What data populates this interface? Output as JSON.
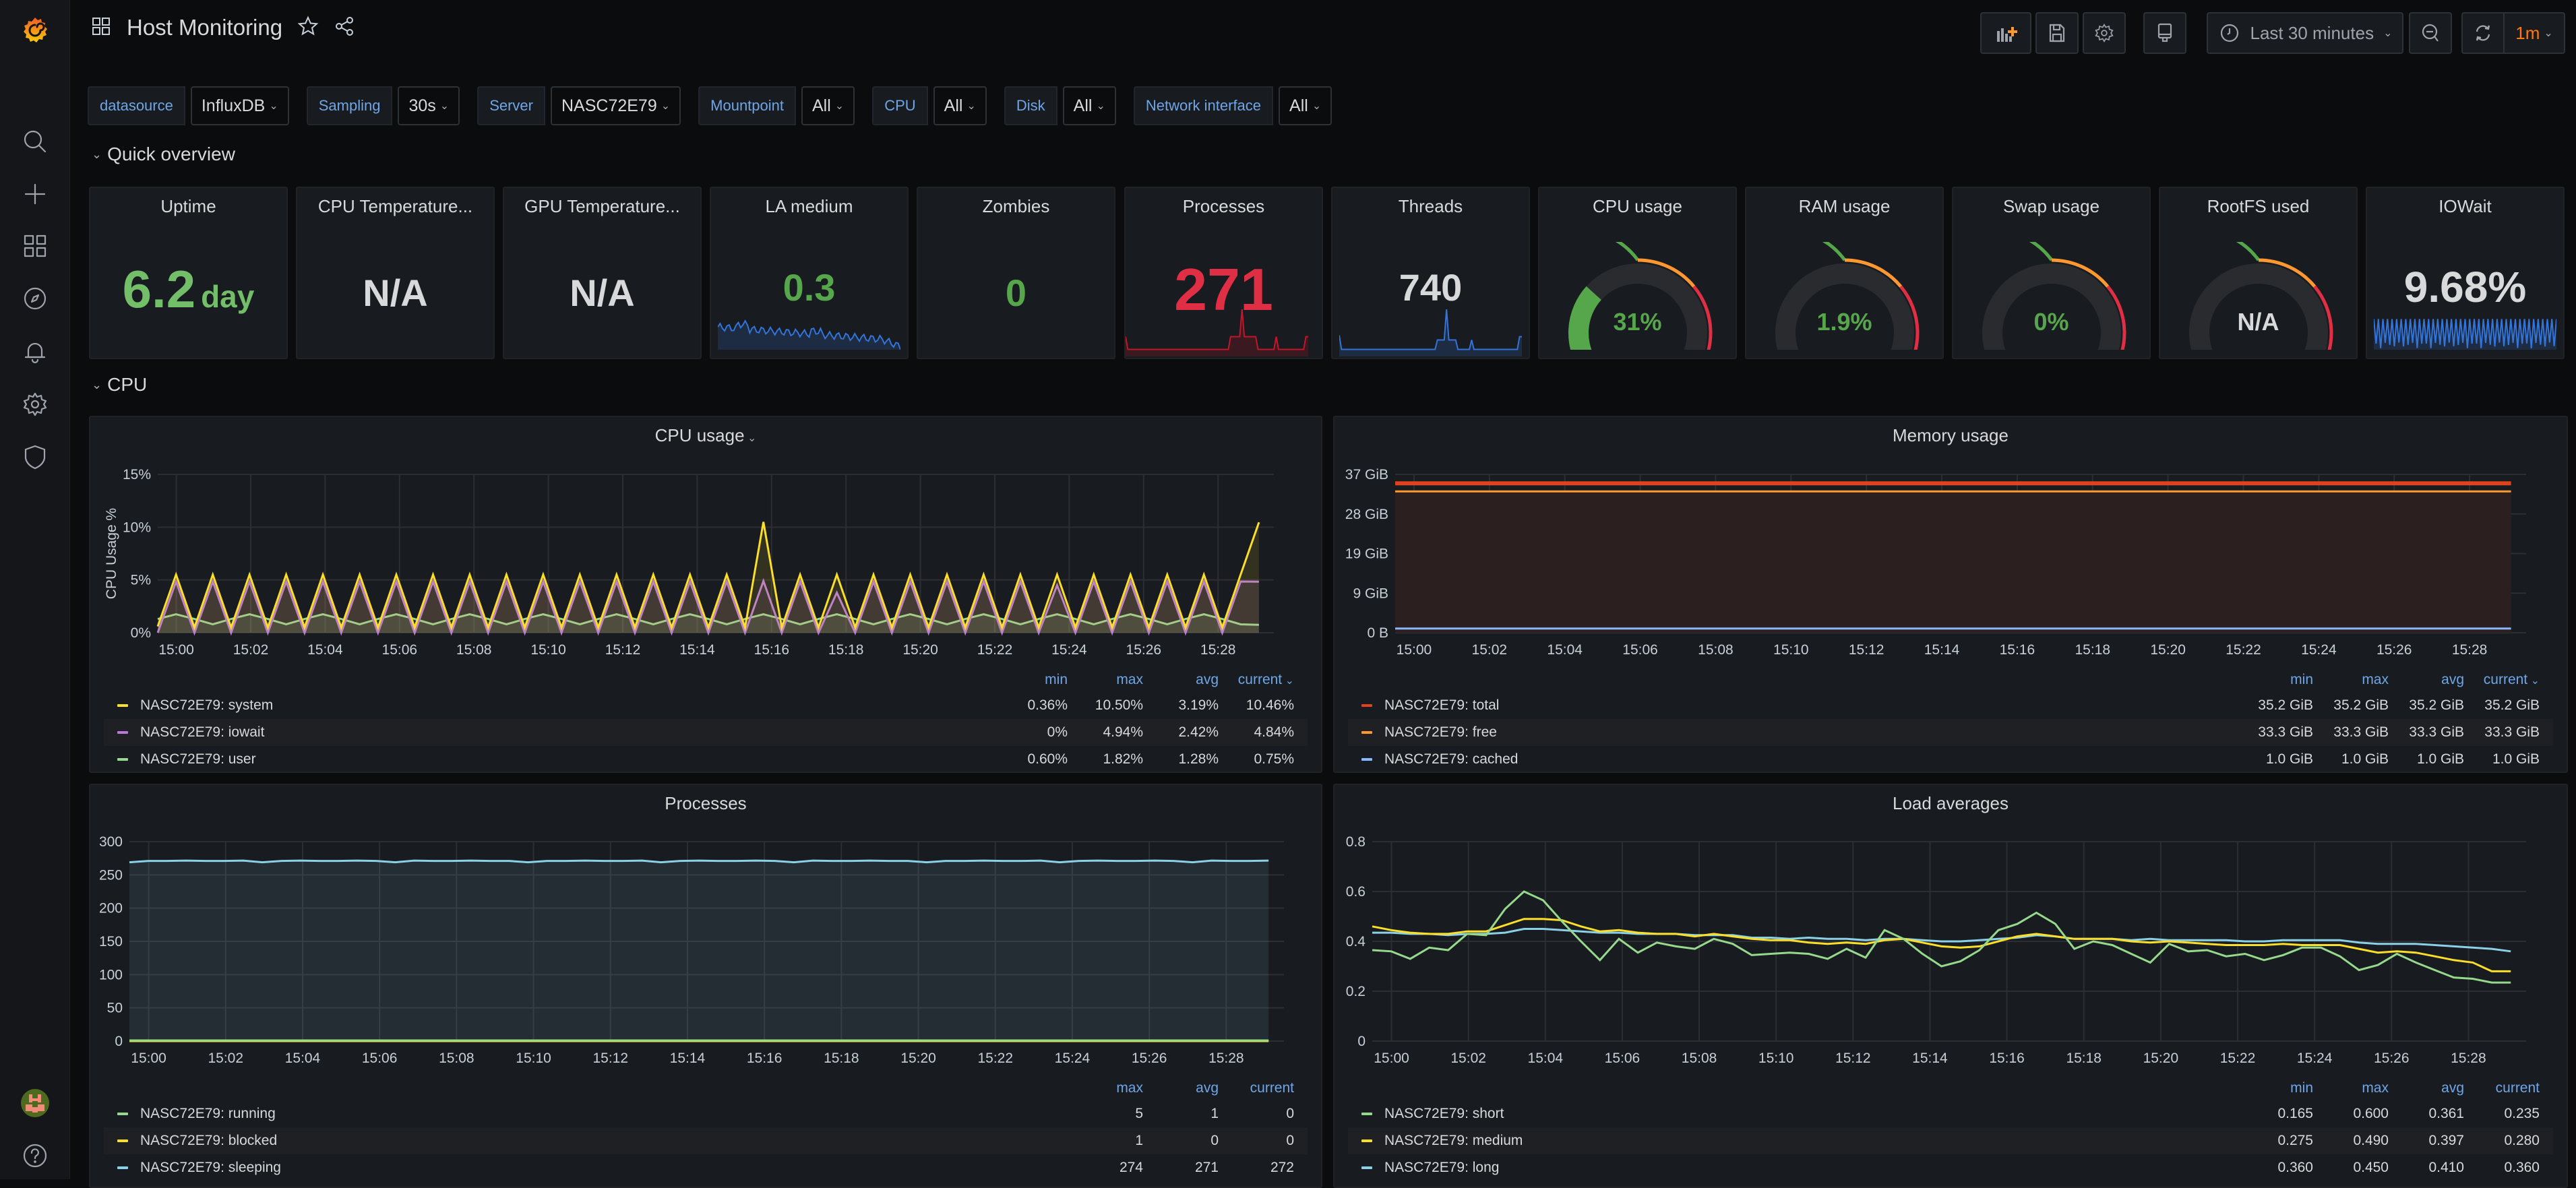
{
  "app": {
    "title": "Host Monitoring"
  },
  "sidebar": {
    "items": [
      {
        "name": "search",
        "icon": "search-icon"
      },
      {
        "name": "create",
        "icon": "plus-icon"
      },
      {
        "name": "dashboards",
        "icon": "apps-icon"
      },
      {
        "name": "explore",
        "icon": "compass-icon"
      },
      {
        "name": "alerting",
        "icon": "bell-icon"
      },
      {
        "name": "configuration",
        "icon": "gear-icon"
      },
      {
        "name": "server-admin",
        "icon": "shield-icon"
      }
    ],
    "bottom": [
      {
        "name": "profile",
        "icon": "avatar"
      },
      {
        "name": "help",
        "icon": "question-icon"
      }
    ]
  },
  "toolbar": {
    "add_panel": "add-panel-icon",
    "save": "save-icon",
    "settings": "gear-icon",
    "tv_mode": "monitor-icon",
    "time_range": "Last 30 minutes",
    "zoom_out": "zoom-out-icon",
    "refresh": "sync-icon",
    "refresh_interval": "1m",
    "accent": "#ff780a"
  },
  "variables": [
    {
      "label": "datasource",
      "value": "InfluxDB"
    },
    {
      "label": "Sampling",
      "value": "30s"
    },
    {
      "label": "Server",
      "value": "NASC72E79"
    },
    {
      "label": "Mountpoint",
      "value": "All"
    },
    {
      "label": "CPU",
      "value": "All"
    },
    {
      "label": "Disk",
      "value": "All"
    },
    {
      "label": "Network interface",
      "value": "All"
    }
  ],
  "rows": {
    "quick_overview": "Quick overview",
    "cpu": "CPU"
  },
  "stats": [
    {
      "title": "Uptime",
      "value": "6.2",
      "unit": "day",
      "color": "#73bf69",
      "type": "stat"
    },
    {
      "title": "CPU Temperature...",
      "value": "N/A",
      "color": "#d8d9da",
      "type": "stat"
    },
    {
      "title": "GPU Temperature...",
      "value": "N/A",
      "color": "#d8d9da",
      "type": "stat"
    },
    {
      "title": "LA medium",
      "value": "0.3",
      "color": "#56a64b",
      "type": "spark",
      "spark_color": "#3274d9"
    },
    {
      "title": "Zombies",
      "value": "0",
      "color": "#56a64b",
      "type": "stat"
    },
    {
      "title": "Processes",
      "value": "271",
      "color": "#e02f44",
      "type": "spark",
      "spark_color": "#c4162a"
    },
    {
      "title": "Threads",
      "value": "740",
      "color": "#d8d9da",
      "type": "spark",
      "spark_color": "#3274d9"
    },
    {
      "title": "CPU usage",
      "value": "31%",
      "percent": 31,
      "color": "#56a64b",
      "type": "gauge"
    },
    {
      "title": "RAM usage",
      "value": "1.9%",
      "percent": 1.9,
      "color": "#56a64b",
      "type": "gauge"
    },
    {
      "title": "Swap usage",
      "value": "0%",
      "percent": 0,
      "color": "#56a64b",
      "type": "gauge"
    },
    {
      "title": "RootFS used",
      "value": "N/A",
      "percent": null,
      "color": "#d8d9da",
      "type": "gauge"
    },
    {
      "title": "IOWait",
      "value": "9.68%",
      "color": "#d8d9da",
      "type": "spark",
      "spark_color": "#3274d9"
    }
  ],
  "chart_data": [
    {
      "id": "cpu",
      "type": "line",
      "title": "CPU usage",
      "title_menu": true,
      "ylabel": "CPU Usage %",
      "yticks": [
        "0%",
        "5%",
        "10%",
        "15%"
      ],
      "ylim": [
        0,
        15
      ],
      "xticks": [
        "15:00",
        "15:02",
        "15:04",
        "15:06",
        "15:08",
        "15:10",
        "15:12",
        "15:14",
        "15:16",
        "15:18",
        "15:20",
        "15:22",
        "15:24",
        "15:26",
        "15:28"
      ],
      "xlim_minutes": [
        -0.5,
        29.5
      ],
      "legend_columns": [
        "min",
        "max",
        "avg",
        "current"
      ],
      "sort_column": "current",
      "series": [
        {
          "name": "NASC72E79: system",
          "color": "#fade2a",
          "stats": [
            "0.36%",
            "10.50%",
            "3.19%",
            "10.46%"
          ],
          "pattern": "cpu_system"
        },
        {
          "name": "NASC72E79: iowait",
          "color": "#b877d9",
          "stats": [
            "0%",
            "4.94%",
            "2.42%",
            "4.84%"
          ],
          "pattern": "cpu_iowait"
        },
        {
          "name": "NASC72E79: user",
          "color": "#96d98d",
          "stats": [
            "0.60%",
            "1.82%",
            "1.28%",
            "0.75%"
          ],
          "pattern": "cpu_user"
        }
      ]
    },
    {
      "id": "mem",
      "type": "area",
      "title": "Memory usage",
      "yticks": [
        "0 B",
        "9 GiB",
        "19 GiB",
        "28 GiB",
        "37 GiB"
      ],
      "ylim": [
        0,
        37.3
      ],
      "xticks": [
        "15:00",
        "15:02",
        "15:04",
        "15:06",
        "15:08",
        "15:10",
        "15:12",
        "15:14",
        "15:16",
        "15:18",
        "15:20",
        "15:22",
        "15:24",
        "15:26",
        "15:28"
      ],
      "xlim_minutes": [
        -0.5,
        29.5
      ],
      "legend_columns": [
        "min",
        "max",
        "avg",
        "current"
      ],
      "sort_column": "current",
      "series": [
        {
          "name": "NASC72E79: total",
          "color": "#e0421f",
          "stats": [
            "35.2 GiB",
            "35.2 GiB",
            "35.2 GiB",
            "35.2 GiB"
          ],
          "value": 35.2
        },
        {
          "name": "NASC72E79: free",
          "color": "#ff9830",
          "stats": [
            "33.3 GiB",
            "33.3 GiB",
            "33.3 GiB",
            "33.3 GiB"
          ],
          "value": 33.3
        },
        {
          "name": "NASC72E79: cached",
          "color": "#8ab8ff",
          "stats": [
            "1.0 GiB",
            "1.0 GiB",
            "1.0 GiB",
            "1.0 GiB"
          ],
          "value": 1.0
        }
      ]
    },
    {
      "id": "proc",
      "type": "area",
      "title": "Processes",
      "yticks": [
        "0",
        "50",
        "100",
        "150",
        "200",
        "250",
        "300"
      ],
      "ylim": [
        0,
        300
      ],
      "xticks": [
        "15:00",
        "15:02",
        "15:04",
        "15:06",
        "15:08",
        "15:10",
        "15:12",
        "15:14",
        "15:16",
        "15:18",
        "15:20",
        "15:22",
        "15:24",
        "15:26",
        "15:28"
      ],
      "xlim_minutes": [
        -0.5,
        29.5
      ],
      "legend_columns": [
        "max",
        "avg",
        "current"
      ],
      "series": [
        {
          "name": "NASC72E79: running",
          "color": "#96d98d",
          "stats": [
            "5",
            "1",
            "0"
          ],
          "value": 1
        },
        {
          "name": "NASC72E79: blocked",
          "color": "#fade2a",
          "stats": [
            "1",
            "0",
            "0"
          ],
          "value": 0
        },
        {
          "name": "NASC72E79: sleeping",
          "color": "#8ad1e8",
          "stats": [
            "274",
            "271",
            "272"
          ],
          "value": 271
        }
      ]
    },
    {
      "id": "load",
      "type": "line",
      "title": "Load averages",
      "yticks": [
        "0",
        "0.2",
        "0.4",
        "0.6",
        "0.8"
      ],
      "ylim": [
        0,
        0.8
      ],
      "xticks": [
        "15:00",
        "15:02",
        "15:04",
        "15:06",
        "15:08",
        "15:10",
        "15:12",
        "15:14",
        "15:16",
        "15:18",
        "15:20",
        "15:22",
        "15:24",
        "15:26",
        "15:28"
      ],
      "xlim_minutes": [
        -0.5,
        29.5
      ],
      "legend_columns": [
        "min",
        "max",
        "avg",
        "current"
      ],
      "series": [
        {
          "name": "NASC72E79: short",
          "color": "#96d98d",
          "stats": [
            "0.165",
            "0.600",
            "0.361",
            "0.235"
          ],
          "values": [
            0.365,
            0.36,
            0.33,
            0.375,
            0.365,
            0.43,
            0.425,
            0.53,
            0.6,
            0.565,
            0.48,
            0.4,
            0.325,
            0.41,
            0.355,
            0.395,
            0.38,
            0.37,
            0.41,
            0.39,
            0.345,
            0.35,
            0.355,
            0.35,
            0.33,
            0.37,
            0.335,
            0.445,
            0.41,
            0.35,
            0.3,
            0.32,
            0.365,
            0.445,
            0.47,
            0.515,
            0.47,
            0.37,
            0.4,
            0.385,
            0.35,
            0.315,
            0.39,
            0.36,
            0.365,
            0.34,
            0.35,
            0.325,
            0.345,
            0.375,
            0.375,
            0.34,
            0.285,
            0.305,
            0.35,
            0.315,
            0.285,
            0.255,
            0.25,
            0.235,
            0.235
          ]
        },
        {
          "name": "NASC72E79: medium",
          "color": "#fade2a",
          "stats": [
            "0.275",
            "0.490",
            "0.397",
            "0.280"
          ],
          "values": [
            0.46,
            0.445,
            0.435,
            0.43,
            0.43,
            0.44,
            0.44,
            0.465,
            0.49,
            0.49,
            0.485,
            0.46,
            0.44,
            0.445,
            0.435,
            0.43,
            0.43,
            0.42,
            0.43,
            0.42,
            0.41,
            0.405,
            0.405,
            0.395,
            0.39,
            0.395,
            0.39,
            0.405,
            0.41,
            0.395,
            0.38,
            0.375,
            0.38,
            0.4,
            0.42,
            0.43,
            0.42,
            0.41,
            0.41,
            0.41,
            0.4,
            0.395,
            0.4,
            0.395,
            0.39,
            0.385,
            0.385,
            0.385,
            0.39,
            0.385,
            0.385,
            0.385,
            0.37,
            0.355,
            0.36,
            0.355,
            0.34,
            0.325,
            0.315,
            0.28,
            0.28
          ]
        },
        {
          "name": "NASC72E79: long",
          "color": "#8ad1e8",
          "stats": [
            "0.360",
            "0.450",
            "0.410",
            "0.360"
          ],
          "values": [
            0.435,
            0.435,
            0.43,
            0.43,
            0.425,
            0.43,
            0.43,
            0.435,
            0.45,
            0.45,
            0.445,
            0.44,
            0.435,
            0.435,
            0.43,
            0.43,
            0.43,
            0.425,
            0.425,
            0.425,
            0.415,
            0.415,
            0.41,
            0.415,
            0.41,
            0.41,
            0.405,
            0.41,
            0.41,
            0.405,
            0.4,
            0.4,
            0.405,
            0.41,
            0.415,
            0.425,
            0.42,
            0.41,
            0.41,
            0.41,
            0.405,
            0.41,
            0.405,
            0.405,
            0.405,
            0.405,
            0.4,
            0.4,
            0.405,
            0.405,
            0.405,
            0.405,
            0.395,
            0.39,
            0.39,
            0.39,
            0.385,
            0.38,
            0.375,
            0.37,
            0.36
          ]
        }
      ]
    }
  ]
}
